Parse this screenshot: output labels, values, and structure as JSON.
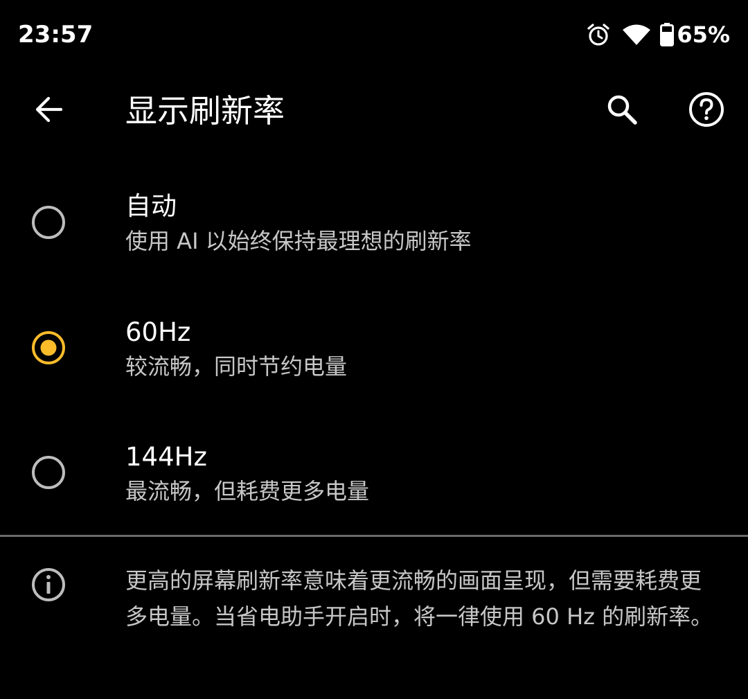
{
  "status_bar": {
    "time": "23:57",
    "battery_percent": "65%",
    "icons": [
      "alarm-icon",
      "wifi-icon",
      "battery-icon"
    ]
  },
  "app_bar": {
    "title": "显示刷新率",
    "back_icon": "arrow-back-icon",
    "search_icon": "search-icon",
    "help_icon": "help-icon"
  },
  "options": [
    {
      "title": "自动",
      "summary": "使用 AI 以始终保持最理想的刷新率",
      "selected": false
    },
    {
      "title": "60Hz",
      "summary": "较流畅，同时节约电量",
      "selected": true
    },
    {
      "title": "144Hz",
      "summary": "最流畅，但耗费更多电量",
      "selected": false
    }
  ],
  "footer": {
    "icon": "info-icon",
    "text": "更高的屏幕刷新率意味着更流畅的画面呈现，但需要耗费更多电量。当省电助手开启时，将一律使用 60 Hz 的刷新率。"
  },
  "colors": {
    "background": "#000000",
    "accent": "#fbbc2a",
    "radio_unchecked": "#bdbdbd",
    "secondary_text": "#c7c7c7",
    "divider": "#6b6b6b"
  }
}
